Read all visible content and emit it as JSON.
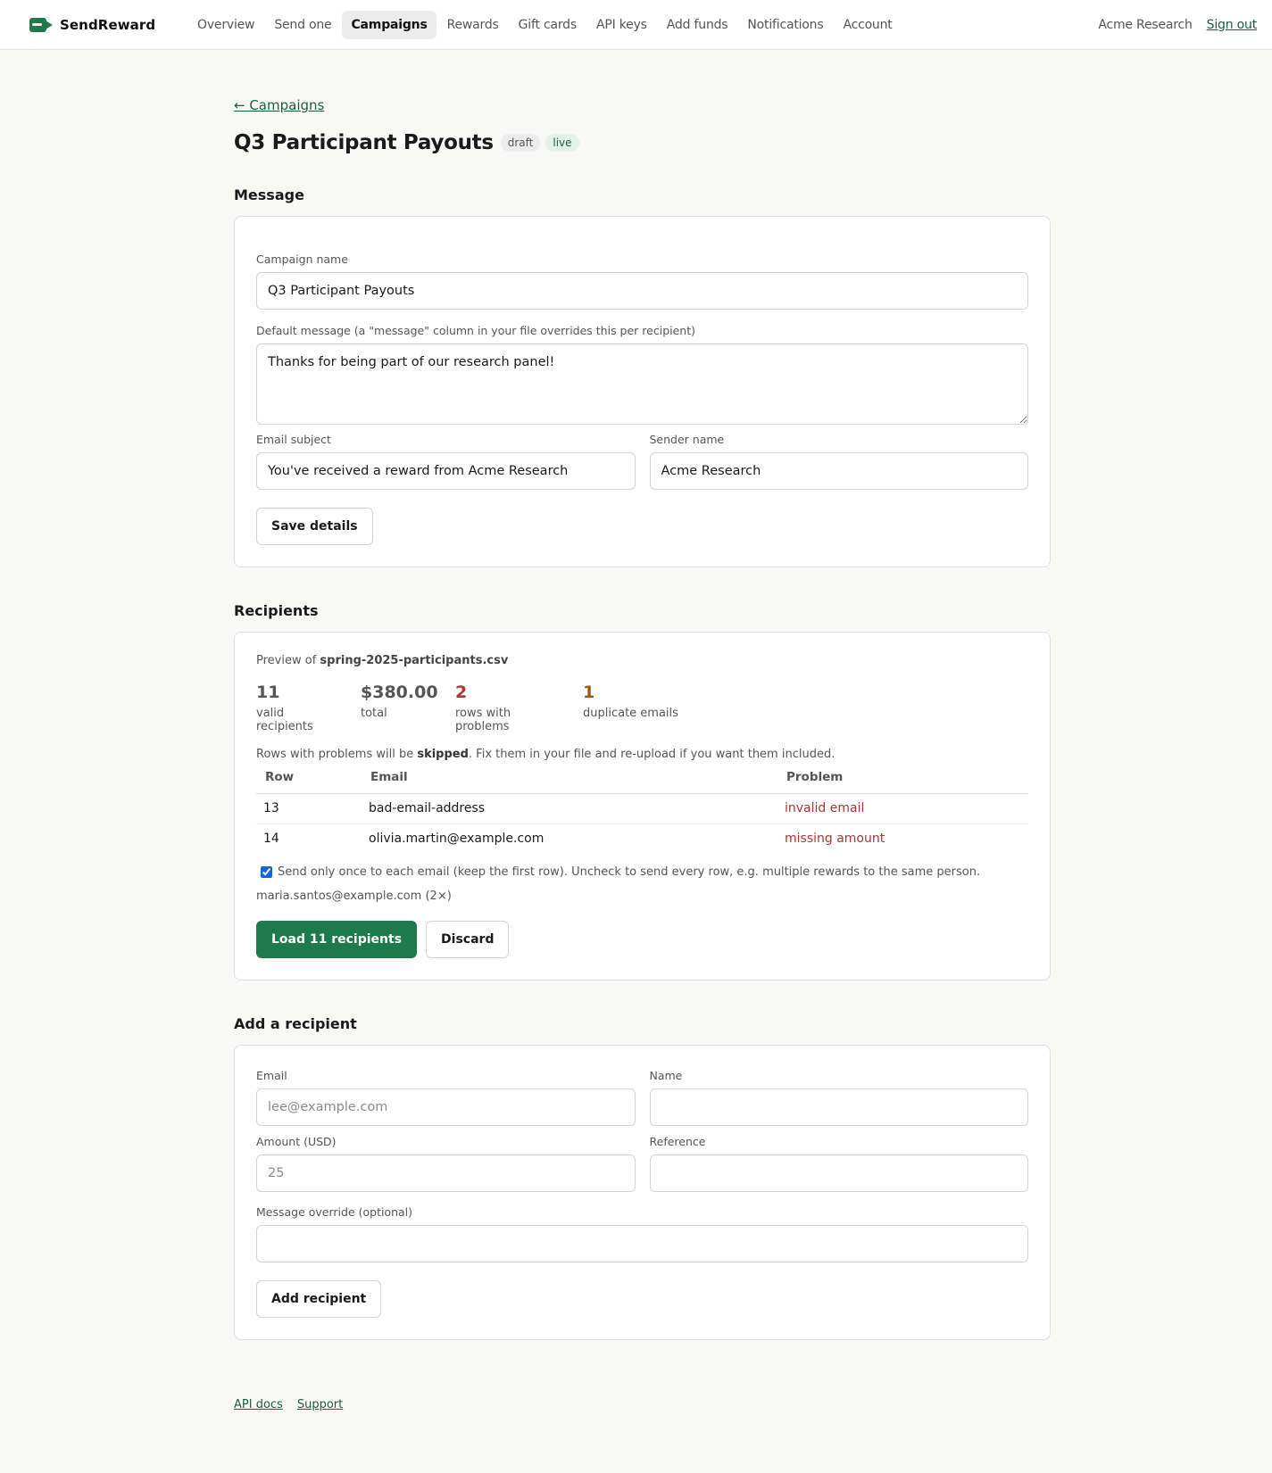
{
  "app": {
    "brand": "SendReward",
    "org_name": "Acme Research",
    "sign_out": "Sign out",
    "accent_color": "#1e7a4a"
  },
  "nav": {
    "items": [
      {
        "label": "Overview",
        "active": false
      },
      {
        "label": "Send one",
        "active": false
      },
      {
        "label": "Campaigns",
        "active": true
      },
      {
        "label": "Rewards",
        "active": false
      },
      {
        "label": "Gift cards",
        "active": false
      },
      {
        "label": "API keys",
        "active": false
      },
      {
        "label": "Add funds",
        "active": false
      },
      {
        "label": "Notifications",
        "active": false
      },
      {
        "label": "Account",
        "active": false
      }
    ]
  },
  "page": {
    "back_link": "← Campaigns",
    "title": "Q3 Participant Payouts",
    "badges": [
      "draft",
      "live"
    ]
  },
  "message_section": {
    "title": "Message",
    "campaign_name_label": "Campaign name",
    "campaign_name_value": "Q3 Participant Payouts",
    "default_message_label": "Default message (a \"message\" column in your file overrides this per recipient)",
    "default_message_value": "Thanks for being part of our research panel!",
    "email_subject_label": "Email subject",
    "email_subject_value": "You've received a reward from Acme Research",
    "sender_name_label": "Sender name",
    "sender_name_value": "Acme Research",
    "save_button": "Save details"
  },
  "recipients_section": {
    "title": "Recipients",
    "preview_prefix": "Preview of ",
    "file_name": "spring-2025-participants.csv",
    "stats": [
      {
        "value": "11",
        "label": "valid recipients",
        "tone": "neutral"
      },
      {
        "value": "$380.00",
        "label": "total",
        "tone": "neutral"
      },
      {
        "value": "2",
        "label": "rows with problems",
        "tone": "red"
      },
      {
        "value": "1",
        "label": "duplicate emails",
        "tone": "amber"
      }
    ],
    "note_prefix": "Rows with problems will be ",
    "note_bold": "skipped",
    "note_suffix": ". Fix them in your file and re-upload if you want them included.",
    "table_headers": {
      "row": "Row",
      "email": "Email",
      "problem": "Problem"
    },
    "problem_rows": [
      {
        "row": "13",
        "email": "bad-email-address",
        "problem": "invalid email"
      },
      {
        "row": "14",
        "email": "olivia.martin@example.com",
        "problem": "missing amount"
      }
    ],
    "dedupe_checked": true,
    "dedupe_label": "Send only once to each email (keep the first row). Uncheck to send every row, e.g. multiple rewards to the same person.",
    "duplicate_line": "maria.santos@example.com (2×)",
    "load_button": "Load 11 recipients",
    "discard_button": "Discard"
  },
  "add_recipient_section": {
    "title": "Add a recipient",
    "email_label": "Email",
    "email_placeholder": "lee@example.com",
    "name_label": "Name",
    "amount_label": "Amount (USD)",
    "amount_placeholder": "25",
    "reference_label": "Reference",
    "message_override_label": "Message override (optional)",
    "add_button": "Add recipient"
  },
  "footer": {
    "links": [
      "API docs",
      "Support"
    ]
  }
}
